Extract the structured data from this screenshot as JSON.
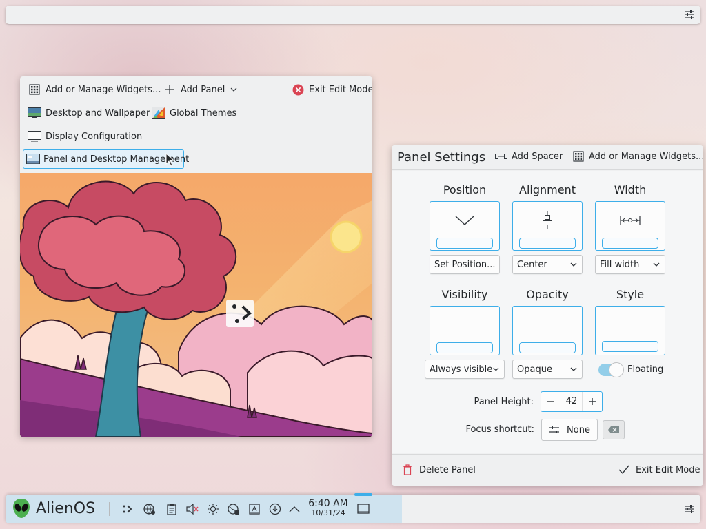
{
  "toolbox": {
    "add_widgets": "Add or Manage Widgets...",
    "add_panel": "Add Panel",
    "exit_edit": "Exit Edit Mode",
    "desktop_wallpaper": "Desktop and Wallpaper",
    "global_themes": "Global Themes",
    "display_config": "Display Configuration",
    "panel_desktop_mgmt": "Panel and Desktop Management"
  },
  "panel_settings": {
    "title": "Panel Settings",
    "add_spacer": "Add Spacer",
    "add_widgets": "Add or Manage Widgets...",
    "position": {
      "label": "Position",
      "value": "Set Position..."
    },
    "alignment": {
      "label": "Alignment",
      "value": "Center"
    },
    "width": {
      "label": "Width",
      "value": "Fill width"
    },
    "visibility": {
      "label": "Visibility",
      "value": "Always visible"
    },
    "opacity": {
      "label": "Opacity",
      "value": "Opaque"
    },
    "style": {
      "label": "Style",
      "value": "Floating",
      "floating_on": true
    },
    "panel_height_label": "Panel Height:",
    "panel_height": "42",
    "focus_shortcut_label": "Focus shortcut:",
    "focus_shortcut": "None",
    "delete_panel": "Delete Panel",
    "exit_edit": "Exit Edit Mode"
  },
  "bottom_panel": {
    "launcher_name": "AlienOS",
    "tray_icons": [
      "kde-connect-icon",
      "network-icon",
      "clipboard-icon",
      "volume-muted-icon",
      "brightness-icon",
      "vpn-globe-icon",
      "notes-icon",
      "updates-icon",
      "expand-tray-icon"
    ],
    "time": "6:40 AM",
    "date": "10/31/24"
  },
  "colors": {
    "accent": "#3daee9",
    "panel_bg": "#eff0f1",
    "close_red": "#da4453",
    "delete_red": "#da4453"
  }
}
